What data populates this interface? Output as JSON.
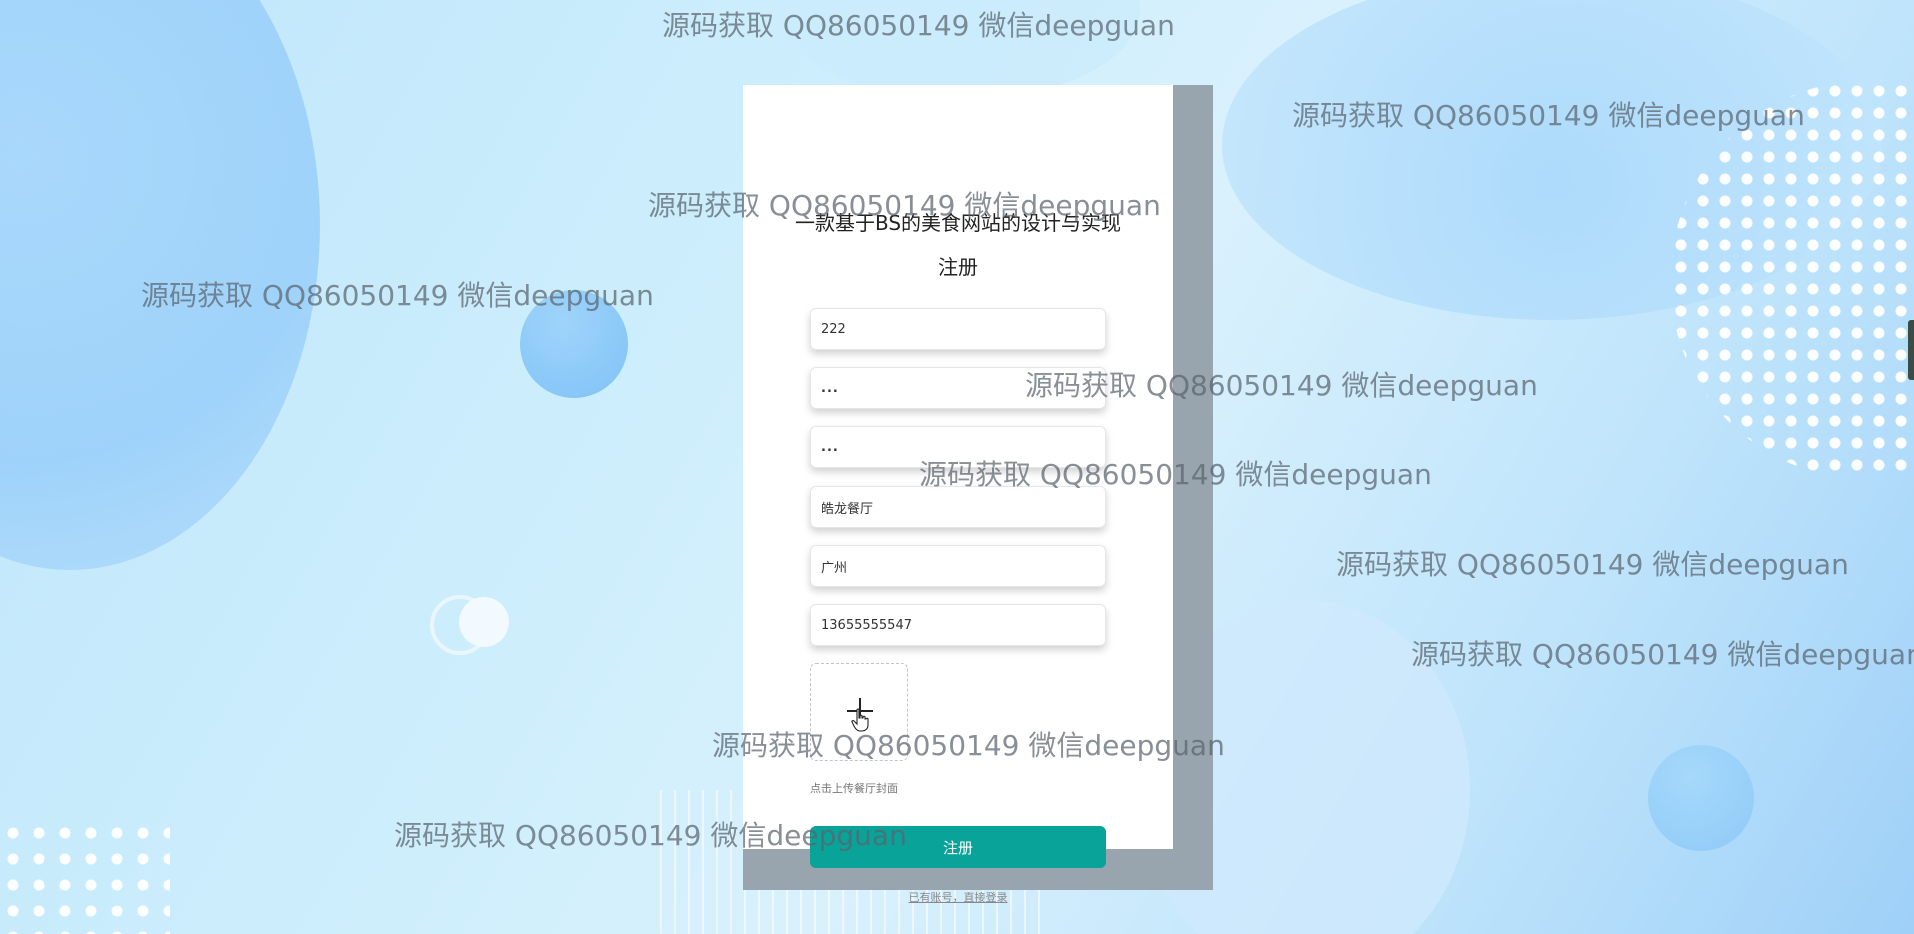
{
  "site_title": "一款基于BS的美食网站的设计与实现",
  "form": {
    "heading": "注册",
    "fields": [
      {
        "name": "username",
        "value": "222",
        "type": "text"
      },
      {
        "name": "password",
        "value": "...",
        "type": "password-masked"
      },
      {
        "name": "confirm_password",
        "value": "...",
        "type": "password-masked"
      },
      {
        "name": "restaurant_name",
        "value": "皓龙餐厅",
        "type": "text"
      },
      {
        "name": "address",
        "value": "广州",
        "type": "text"
      },
      {
        "name": "phone",
        "value": "13655555547",
        "type": "text"
      }
    ],
    "upload": {
      "icon": "plus-icon",
      "hint": "点击上传餐厅封面"
    },
    "submit_label": "注册",
    "login_link": "已有账号，直接登录"
  },
  "watermark_text": "源码获取 QQ86050149 微信deepguan",
  "colors": {
    "accent": "#0aa39a",
    "card": "#ffffff",
    "card_shadow": "#98a4ae"
  }
}
